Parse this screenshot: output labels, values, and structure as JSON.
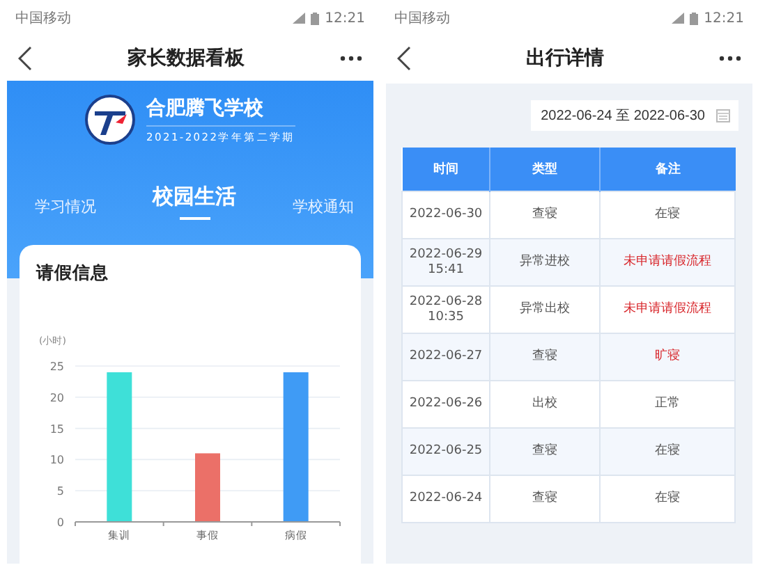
{
  "left_screen": {
    "status_bar": {
      "carrier": "中国移动",
      "time": "12:21"
    },
    "nav_bar": {
      "title": "家长数据看板"
    },
    "school": {
      "name": "合肥腾飞学校",
      "term": "2021-2022学年第二学期"
    },
    "tabs": [
      {
        "label": "学习情况",
        "selected": false
      },
      {
        "label": "校园生活",
        "selected": true
      },
      {
        "label": "学校通知",
        "selected": false
      }
    ],
    "leave_card": {
      "title": "请假信息",
      "chart_data": {
        "type": "bar",
        "ylabel": "(小时)",
        "categories": [
          "集训",
          "事假",
          "病假"
        ],
        "values": [
          24,
          11,
          24
        ],
        "colors": [
          "#3ee0d8",
          "#eb7068",
          "#3f9bf5"
        ],
        "ylim": [
          0,
          25
        ],
        "grid": true,
        "yticks": [
          0,
          5,
          10,
          15,
          20,
          25
        ]
      }
    }
  },
  "right_screen": {
    "status_bar": {
      "carrier": "中国移动",
      "time": "12:21"
    },
    "nav_bar": {
      "title": "出行详情"
    },
    "date_range": "2022-06-24 至 2022-06-30",
    "table": {
      "columns": [
        "时间",
        "类型",
        "备注"
      ],
      "rows": [
        {
          "time": "2022-06-30",
          "type": "查寝",
          "note": "在寝",
          "alert": false
        },
        {
          "time": "2022-06-29 15:41",
          "type": "异常进校",
          "note": "未申请请假流程",
          "alert": true
        },
        {
          "time": "2022-06-28 10:35",
          "type": "异常出校",
          "note": "未申请请假流程",
          "alert": true
        },
        {
          "time": "2022-06-27",
          "type": "查寝",
          "note": "旷寝",
          "alert": true
        },
        {
          "time": "2022-06-26",
          "type": "出校",
          "note": "正常",
          "alert": false
        },
        {
          "time": "2022-06-25",
          "type": "查寝",
          "note": "在寝",
          "alert": false
        },
        {
          "time": "2022-06-24",
          "type": "查寝",
          "note": "在寝",
          "alert": false
        }
      ]
    }
  }
}
